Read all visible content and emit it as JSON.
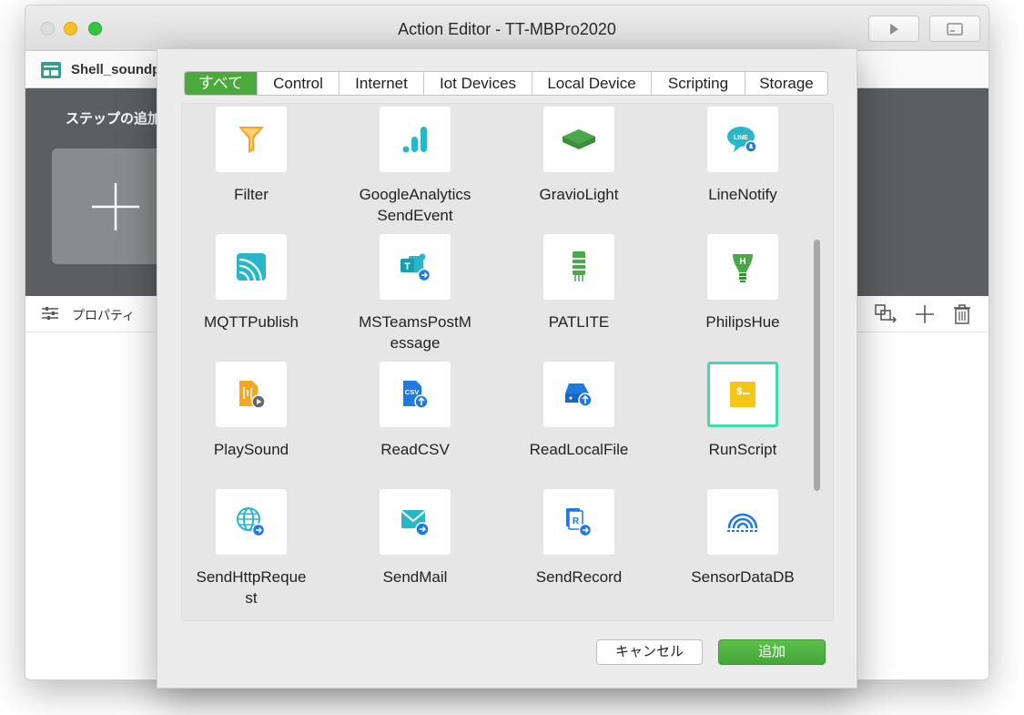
{
  "window": {
    "title": "Action Editor - TT-MBPro2020"
  },
  "document": {
    "name": "Shell_soundp"
  },
  "editor": {
    "step_label": "ステップの追加",
    "properties_label": "プロパティ"
  },
  "dialog": {
    "tabs": [
      {
        "label": "すべて",
        "active": true
      },
      {
        "label": "Control",
        "active": false
      },
      {
        "label": "Internet",
        "active": false
      },
      {
        "label": "Iot Devices",
        "active": false
      },
      {
        "label": "Local Device",
        "active": false
      },
      {
        "label": "Scripting",
        "active": false
      },
      {
        "label": "Storage",
        "active": false
      }
    ],
    "items": [
      {
        "label": "Filter",
        "icon": "filter-icon"
      },
      {
        "label": "GoogleAnalytics\nSendEvent",
        "icon": "analytics-icon"
      },
      {
        "label": "GravioLight",
        "icon": "gravio-light-icon"
      },
      {
        "label": "LineNotify",
        "icon": "line-notify-icon"
      },
      {
        "label": "MQTTPublish",
        "icon": "mqtt-icon"
      },
      {
        "label": "MSTeamsPostM\nessage",
        "icon": "ms-teams-icon"
      },
      {
        "label": "PATLITE",
        "icon": "patlite-icon"
      },
      {
        "label": "PhilipsHue",
        "icon": "philips-hue-icon"
      },
      {
        "label": "PlaySound",
        "icon": "play-sound-icon"
      },
      {
        "label": "ReadCSV",
        "icon": "read-csv-icon"
      },
      {
        "label": "ReadLocalFile",
        "icon": "read-local-file-icon"
      },
      {
        "label": "RunScript",
        "icon": "run-script-icon",
        "selected": true
      },
      {
        "label": "SendHttpReque\nst",
        "icon": "globe-icon"
      },
      {
        "label": "SendMail",
        "icon": "mail-icon"
      },
      {
        "label": "SendRecord",
        "icon": "send-record-icon"
      },
      {
        "label": "SensorDataDB",
        "icon": "sensor-db-icon"
      }
    ],
    "cancel_label": "キャンセル",
    "add_label": "追加"
  },
  "colors": {
    "accent_green": "#4aaa3c",
    "icon_blue": "#1f7ae0",
    "icon_teal": "#29b6c9",
    "selection": "#45d8b0"
  }
}
